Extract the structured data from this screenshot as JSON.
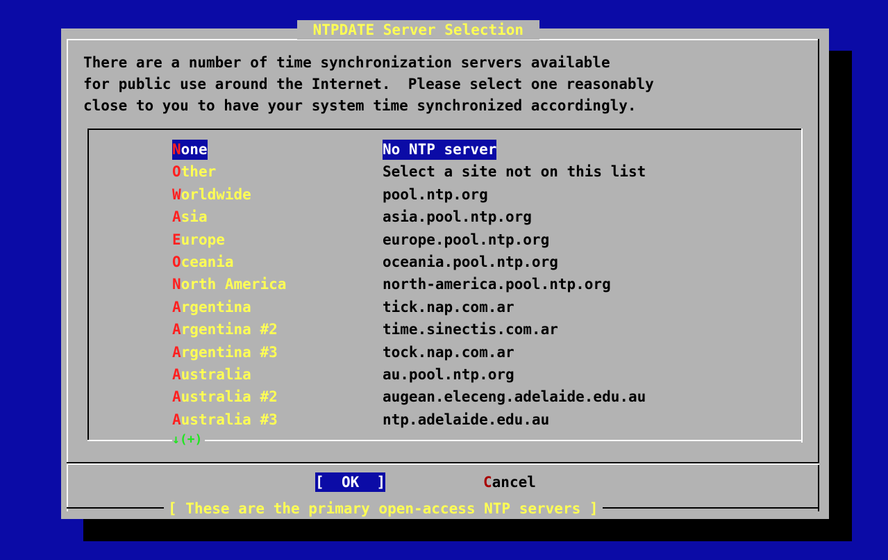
{
  "dialog": {
    "title": " NTPDATE Server Selection ",
    "intro_lines": [
      "There are a number of time synchronization servers available",
      "for public use around the Internet.  Please select one reasonably",
      "close to you to have your system time synchronized accordingly."
    ],
    "items": [
      {
        "hot": "N",
        "rest": "one",
        "desc": "No NTP server",
        "selected": true
      },
      {
        "hot": "O",
        "rest": "ther",
        "desc": "Select a site not on this list"
      },
      {
        "hot": "W",
        "rest": "orldwide",
        "desc": "pool.ntp.org"
      },
      {
        "hot": "A",
        "rest": "sia",
        "desc": "asia.pool.ntp.org"
      },
      {
        "hot": "E",
        "rest": "urope",
        "desc": "europe.pool.ntp.org"
      },
      {
        "hot": "O",
        "rest": "ceania",
        "desc": "oceania.pool.ntp.org"
      },
      {
        "hot": "N",
        "rest": "orth America",
        "desc": "north-america.pool.ntp.org"
      },
      {
        "hot": "A",
        "rest": "rgentina",
        "desc": "tick.nap.com.ar"
      },
      {
        "hot": "A",
        "rest": "rgentina #2",
        "desc": "time.sinectis.com.ar"
      },
      {
        "hot": "A",
        "rest": "rgentina #3",
        "desc": "tock.nap.com.ar"
      },
      {
        "hot": "A",
        "rest": "ustralia",
        "desc": "au.pool.ntp.org"
      },
      {
        "hot": "A",
        "rest": "ustralia #2",
        "desc": "augean.eleceng.adelaide.edu.au"
      },
      {
        "hot": "A",
        "rest": "ustralia #3",
        "desc": "ntp.adelaide.edu.au"
      }
    ],
    "more_indicator": "↓(+)",
    "buttons": {
      "ok_open": "[  ",
      "ok_label": "OK",
      "ok_close": "  ]",
      "cancel_hot": "C",
      "cancel_rest": "ancel"
    },
    "footer_hint": "[ These are the primary open-access NTP servers ]"
  },
  "colors": {
    "background": "#0b0ba6",
    "dialog": "#b3b3b3",
    "tag_text": "#ffff54",
    "hotkey": "#ff2020",
    "more": "#21e621"
  }
}
